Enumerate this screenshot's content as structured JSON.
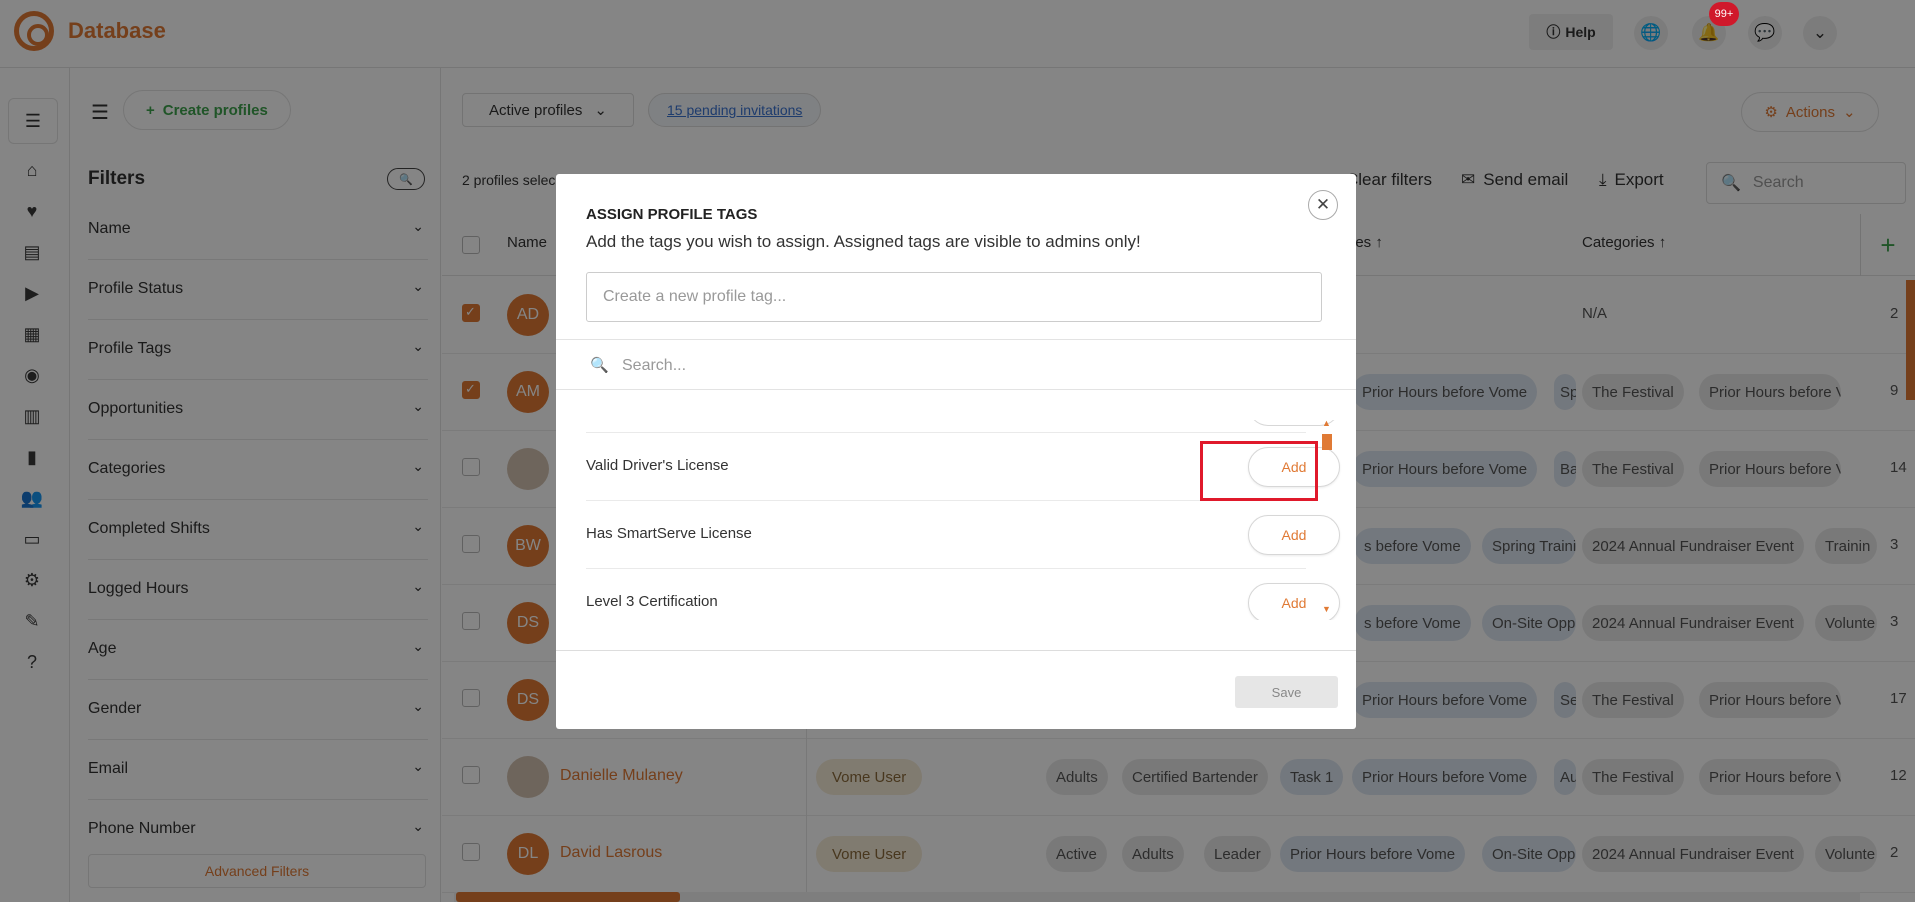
{
  "app": {
    "brand": "Database"
  },
  "topbar": {
    "help_label": "Help",
    "notif_badge": "99+",
    "icons": [
      "globe-icon",
      "bell-icon",
      "chat-icon",
      "chevron-down-icon"
    ]
  },
  "rail": {
    "icons": [
      "filters-icon",
      "home-icon",
      "volunteer-icon",
      "list-icon",
      "play-icon",
      "calendar-icon",
      "palette-icon",
      "board-icon",
      "chart-icon",
      "people-icon",
      "inbox-icon",
      "gear-icon",
      "checklist-icon",
      "help-icon"
    ]
  },
  "filters_panel": {
    "create_label": "Create profiles",
    "title": "Filters",
    "items": [
      "Name",
      "Profile Status",
      "Profile Tags",
      "Opportunities",
      "Categories",
      "Completed Shifts",
      "Logged Hours",
      "Age",
      "Gender",
      "Email",
      "Phone Number"
    ],
    "advanced_label": "Advanced Filters"
  },
  "main": {
    "active_profiles_label": "Active profiles",
    "pending_label": "15 pending invitations",
    "actions_label": "Actions",
    "selected_label": "2 profiles selec",
    "toolbar": {
      "clear_filters": "Clear filters",
      "send_email": "Send email",
      "export": "Export"
    },
    "search_placeholder": "Search",
    "headers": {
      "name": "Name",
      "col_partial": "ies",
      "categories": "Categories"
    },
    "rows": [
      {
        "initials": "AD",
        "name": "",
        "checked": true,
        "cells": [
          "N/A",
          "2"
        ]
      },
      {
        "initials": "AM",
        "name": "",
        "checked": true,
        "cells": [
          "Prior Hours before Vome",
          "Sp",
          "The Festival",
          "Prior Hours before Vome",
          "9"
        ]
      },
      {
        "initials": "",
        "name": "",
        "checked": false,
        "cells": [
          "Prior Hours before Vome",
          "Ba",
          "The Festival",
          "Prior Hours before Vome",
          "14"
        ]
      },
      {
        "initials": "BW",
        "name": "",
        "checked": false,
        "cells": [
          "s before Vome",
          "Spring Traini",
          "2024 Annual Fundraiser Event",
          "Trainin",
          "3"
        ]
      },
      {
        "initials": "DS",
        "name": "",
        "checked": false,
        "cells": [
          "s before Vome",
          "On-Site Opp",
          "2024 Annual Fundraiser Event",
          "Volunte",
          "3"
        ]
      },
      {
        "initials": "DS",
        "name": "",
        "checked": false,
        "cells": [
          "Prior Hours before Vome",
          "Se",
          "The Festival",
          "Prior Hours before Vome",
          "17"
        ]
      },
      {
        "initials": "",
        "name": "Danielle Mulaney",
        "checked": false,
        "role": "Vome User",
        "cells": [
          "Adults",
          "Certified Bartender",
          "Task 1",
          "Prior Hours before Vome",
          "Au",
          "The Festival",
          "Prior Hours before Vome",
          "12"
        ]
      },
      {
        "initials": "DL",
        "name": "David Lasrous",
        "checked": false,
        "role": "Vome User",
        "cells": [
          "Active",
          "Adults",
          "Leader",
          "Prior Hours before Vome",
          "On-Site Opp",
          "2024 Annual Fundraiser Event",
          "Volunte",
          "2"
        ]
      }
    ]
  },
  "modal": {
    "title": "ASSIGN PROFILE TAGS",
    "subtitle": "Add the tags you wish to assign. Assigned tags are visible to admins only!",
    "new_tag_placeholder": "Create a new profile tag...",
    "search_placeholder": "Search...",
    "tags": [
      {
        "name": "Valid Driver's License",
        "add_label": "Add"
      },
      {
        "name": "Has SmartServe License",
        "add_label": "Add"
      },
      {
        "name": "Level 3 Certification",
        "add_label": "Add"
      }
    ],
    "save_label": "Save"
  },
  "colors": {
    "accent": "#e07a35",
    "green": "#3fa34d",
    "highlight": "#e0192b"
  }
}
